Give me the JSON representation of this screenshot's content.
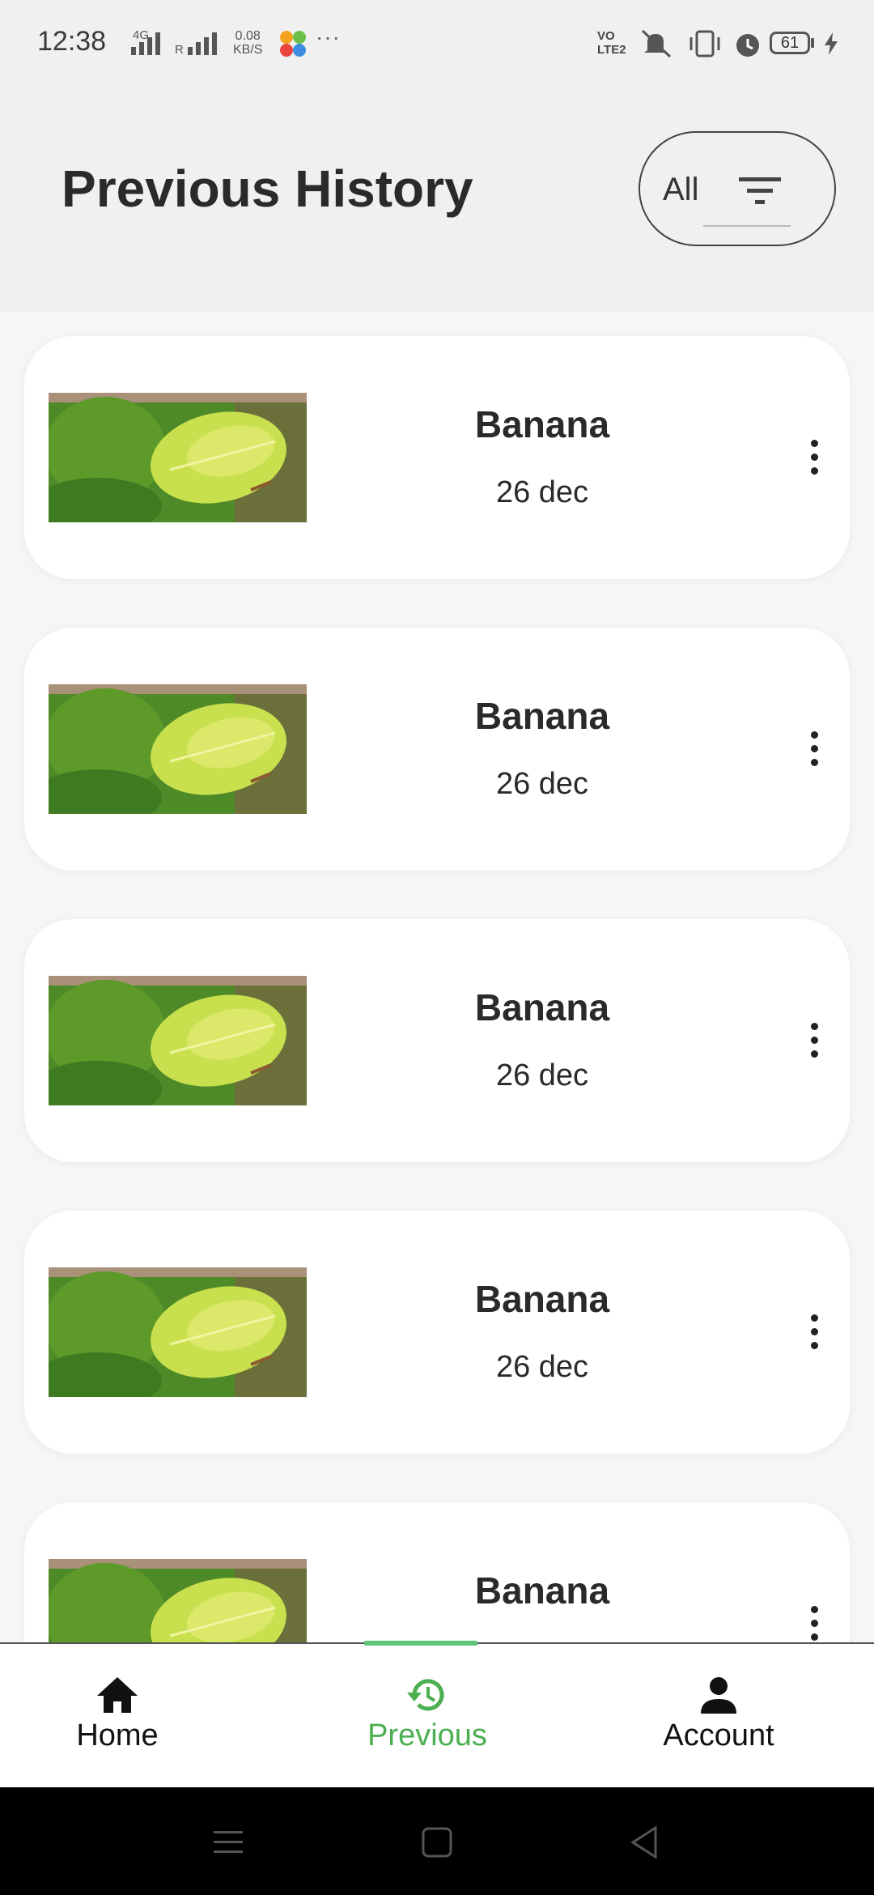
{
  "status_bar": {
    "time": "12:38",
    "network_1": "4G",
    "network_2": "R",
    "speed_value": "0.08",
    "speed_unit": "KB/S",
    "more": "···",
    "volte_line1": "VO",
    "volte_line2": "LTE2",
    "battery": "61"
  },
  "header": {
    "title": "Previous History",
    "filter_label": "All",
    "filter_icon": "filter-icon"
  },
  "history": [
    {
      "name": "Banana",
      "date": "26 dec"
    },
    {
      "name": "Banana",
      "date": "26 dec"
    },
    {
      "name": "Banana",
      "date": "26 dec"
    },
    {
      "name": "Banana",
      "date": "26 dec"
    },
    {
      "name": "Banana",
      "date": ""
    }
  ],
  "bottom_nav": {
    "items": [
      {
        "label": "Home",
        "icon": "home-icon"
      },
      {
        "label": "Previous",
        "icon": "history-icon"
      },
      {
        "label": "Account",
        "icon": "person-icon"
      }
    ],
    "active_index": 1
  },
  "colors": {
    "accent": "#4caf50",
    "background": "#f3f3f3",
    "card": "#ffffff",
    "text": "#2a2a2a"
  }
}
